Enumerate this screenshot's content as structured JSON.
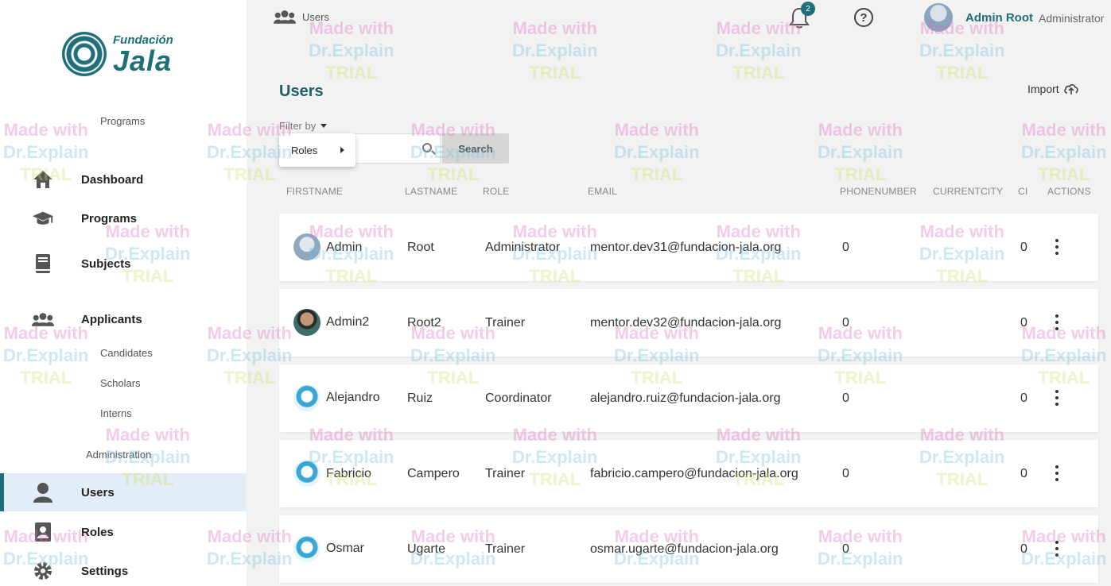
{
  "sidebar": {
    "logo": {
      "line1": "Fundación",
      "line2": "Jala"
    },
    "programs_heading": "Programs",
    "administration_heading": "Administration",
    "items": [
      {
        "label": "Dashboard",
        "icon": "home-icon"
      },
      {
        "label": "Programs",
        "icon": "graduation-cap-icon"
      },
      {
        "label": "Subjects",
        "icon": "book-icon"
      },
      {
        "label": "Applicants",
        "icon": "group-icon"
      },
      {
        "label": "Users",
        "icon": "user-icon"
      },
      {
        "label": "Roles",
        "icon": "id-card-icon"
      },
      {
        "label": "Settings",
        "icon": "gear-icon"
      }
    ],
    "applicant_subitems": [
      "Candidates",
      "Scholars",
      "Interns"
    ],
    "active_item": "Users"
  },
  "topbar": {
    "breadcrumb": "Users",
    "notifications_count": "2",
    "help_glyph": "?",
    "user_name": "Admin Root",
    "user_role": "Administrator"
  },
  "page": {
    "title": "Users",
    "import_label": "Import",
    "filter_label": "Filter by",
    "filter_menu_item": "Roles",
    "search_placeholder": "",
    "search_button": "Search"
  },
  "table": {
    "columns": [
      "FIRSTNAME",
      "LASTNAME",
      "ROLE",
      "EMAIL",
      "PHONENUMBER",
      "CURRENTCITY",
      "CI",
      "ACTIONS"
    ],
    "rows": [
      {
        "firstname": "Admin",
        "lastname": "Root",
        "role": "Administrator",
        "email": "mentor.dev31@fundacion-jala.org",
        "phone": "0",
        "city": "",
        "ci": "0"
      },
      {
        "firstname": "Admin2",
        "lastname": "Root2",
        "role": "Trainer",
        "email": "mentor.dev32@fundacion-jala.org",
        "phone": "0",
        "city": "",
        "ci": "0"
      },
      {
        "firstname": "Alejandro",
        "lastname": "Ruiz",
        "role": "Coordinator",
        "email": "alejandro.ruiz@fundacion-jala.org",
        "phone": "0",
        "city": "",
        "ci": "0"
      },
      {
        "firstname": "Fabricio",
        "lastname": "Campero",
        "role": "Trainer",
        "email": "fabricio.campero@fundacion-jala.org",
        "phone": "0",
        "city": "",
        "ci": "0"
      },
      {
        "firstname": "Osmar",
        "lastname": "Ugarte",
        "role": "Trainer",
        "email": "osmar.ugarte@fundacion-jala.org",
        "phone": "0",
        "city": "",
        "ci": "0"
      }
    ]
  },
  "watermark": {
    "line1": "Made with",
    "line2": "Dr.Explain",
    "line3": "TRIAL"
  },
  "colors": {
    "accent": "#1f6f7a",
    "active_bg": "#e3edf7",
    "page_bg": "#f2f2f2"
  }
}
